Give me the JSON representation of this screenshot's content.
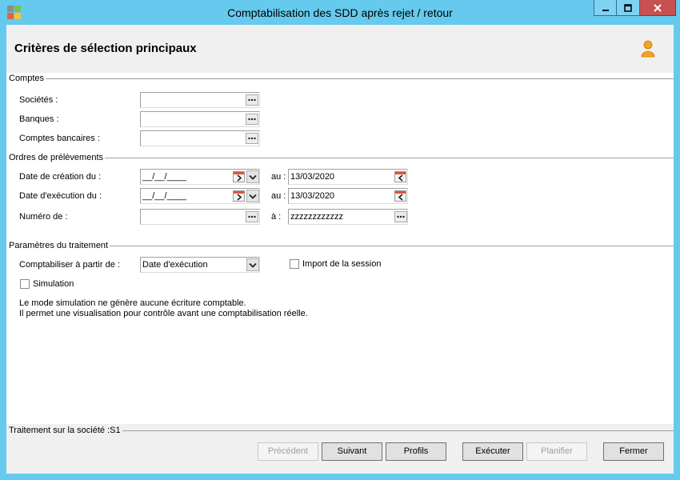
{
  "window": {
    "title": "Comptabilisation des SDD après rejet / retour",
    "icons": {
      "app": "app-icon",
      "minimize": "minimize-icon",
      "maximize": "maximize-icon",
      "close": "close-icon"
    }
  },
  "header": {
    "title": "Critères de sélection principaux",
    "icon": "user-icon"
  },
  "comptes": {
    "label": "Comptes",
    "societes": {
      "label": "Sociétés :"
    },
    "banques": {
      "label": "Banques :"
    },
    "comptes_bancaires": {
      "label": "Comptes bancaires :"
    },
    "browse_icon": "ellipsis-icon"
  },
  "ordres": {
    "label": "Ordres de prélèvements",
    "date_creation": {
      "label": "Date de création du :",
      "from": "__/__/____",
      "to_label": "au :",
      "to": "13/03/2020"
    },
    "date_execution": {
      "label": "Date d'exécution du :",
      "from": "__/__/____",
      "to_label": "au :",
      "to": "13/03/2020"
    },
    "numero": {
      "label": "Numéro de :",
      "to_label": "à :",
      "to": "zzzzzzzzzzzz"
    },
    "icons": {
      "next": "calendar-next-icon",
      "prev": "calendar-prev-icon",
      "dropdown": "chevron-down-icon",
      "browse": "ellipsis-icon"
    }
  },
  "parametres": {
    "label": "Paramètres du traitement",
    "comptabiliser": {
      "label": "Comptabiliser à partir de :",
      "value": "Date d'exécution"
    },
    "import_session": {
      "label": "Import de la session",
      "checked": false
    },
    "simulation": {
      "label": "Simulation",
      "checked": false
    },
    "info": [
      "Le mode simulation ne génère aucune écriture comptable.",
      "Il permet une visualisation pour contrôle avant une comptabilisation réelle."
    ]
  },
  "footer": {
    "status": "Traitement sur la société :S1",
    "buttons": [
      {
        "label": "Précédent",
        "enabled": false
      },
      {
        "label": "Suivant",
        "enabled": true
      },
      {
        "label": "Profils",
        "enabled": true
      },
      {
        "label": "Exécuter",
        "enabled": true
      },
      {
        "label": "Planifier",
        "enabled": false
      },
      {
        "label": "Fermer",
        "enabled": true
      }
    ]
  },
  "colors": {
    "frame": "#66c9ee",
    "close_button": "#c75050",
    "header_bg": "#f0f0f0",
    "user_icon": "#f2a51f",
    "calendar_accent": "#e0553a"
  }
}
